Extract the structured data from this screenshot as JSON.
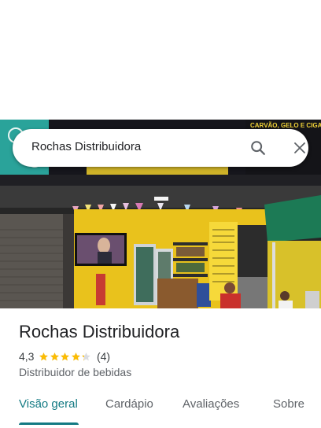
{
  "search": {
    "query": "Rochas Distribuidora"
  },
  "place": {
    "name": "Rochas Distribuidora",
    "rating": "4,3",
    "stars_filled": 4.3,
    "review_count": "(4)",
    "category": "Distribuidor de bebidas"
  },
  "tabs": [
    {
      "label": "Visão geral",
      "active": true
    },
    {
      "label": "Cardápio",
      "active": false
    },
    {
      "label": "Avaliações",
      "active": false
    },
    {
      "label": "Sobre",
      "active": false
    }
  ],
  "photo": {
    "sign_text": "CARVÃO, GELO E CIGARROS"
  },
  "colors": {
    "accent": "#137a83",
    "star": "#fbbc04",
    "wall_yellow": "#e9c21c"
  },
  "icons": {
    "search": "search-icon",
    "close": "close-icon"
  }
}
